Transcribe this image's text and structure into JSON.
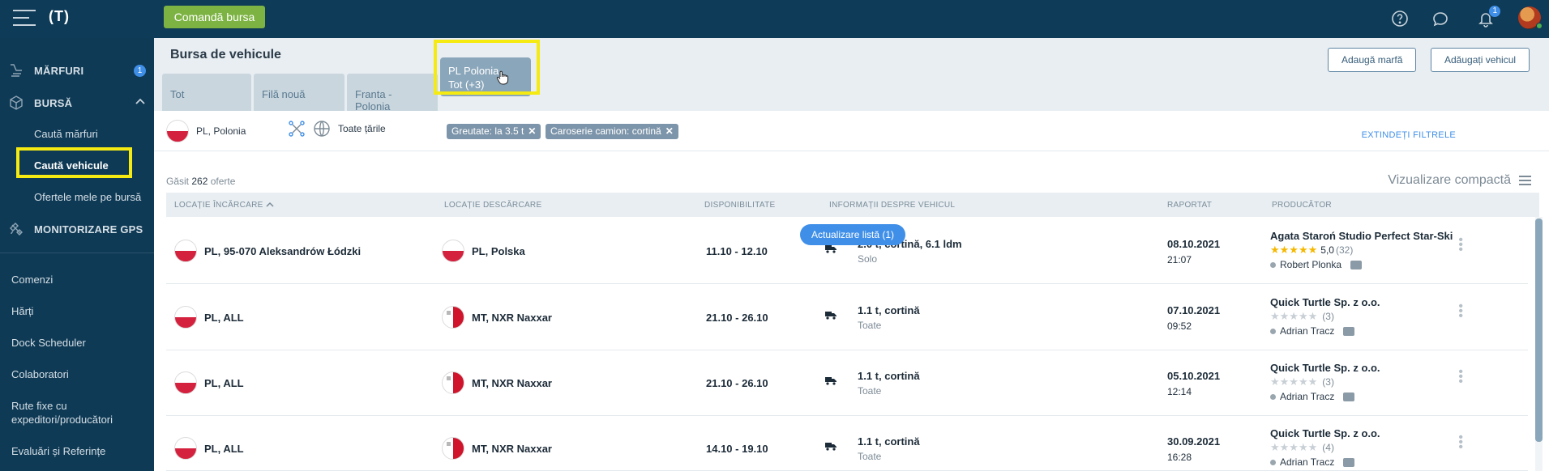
{
  "topbar": {
    "logo": "(T)",
    "cta_label": "Comandă bursa",
    "notif_count": "1",
    "icons": [
      "help-icon",
      "chat-icon",
      "bell-icon"
    ]
  },
  "sidebar": {
    "marfuri_label": "MĂRFURI",
    "marfuri_badge": "1",
    "bursa_label": "BURSĂ",
    "sub_items": [
      "Caută mărfuri",
      "Caută vehicule",
      "Ofertele mele pe bursă"
    ],
    "gps_label": "MONITORIZARE GPS",
    "links": [
      "Comenzi",
      "Hărți",
      "Dock Scheduler",
      "Colaboratori",
      "Rute fixe cu expeditori/producători",
      "Evaluări și Referințe"
    ]
  },
  "header": {
    "title": "Bursa de vehicule",
    "tabs": [
      "Tot",
      "Filă nouă",
      "Franta - Polonia"
    ],
    "active_tab_line1": "PL Polonia",
    "active_tab_line2": "Tot (+3)",
    "btn_add_cargo": "Adaugă marfă",
    "btn_add_vehicle": "Adăugați vehicul"
  },
  "filters": {
    "origin": "PL, Polonia",
    "destination": "Toate țările",
    "chips": [
      "Greutate: la 3.5 t",
      "Caroserie camion: cortină"
    ],
    "extend_label": "EXTINDEȚI FILTRELE"
  },
  "results": {
    "prefix": "Găsit",
    "count": "262",
    "suffix": "oferte",
    "view_label": "Vizualizare compactă",
    "update_pill": "Actualizare listă (1)"
  },
  "table": {
    "headers": [
      "LOCAȚIE ÎNCĂRCARE",
      "LOCAȚIE DESCĂRCARE",
      "DISPONIBILITATE",
      "INFORMAȚII DESPRE VEHICUL",
      "RAPORTAT",
      "PRODUCĂTOR"
    ],
    "rows": [
      {
        "load": "PL, 95-070 Aleksandrów Łódzki",
        "unload": "PL, Polska",
        "unload_flag": "pl",
        "avail": "11.10 - 12.10",
        "veh": "2.0 t, cortină, 6.1 ldm",
        "veh_sub": "Solo",
        "date": "08.10.2021",
        "time": "21:07",
        "producer": "Agata Staroń Studio Perfect Star-Ski",
        "rating": "5,0",
        "rating_count": "(32)",
        "contact": "Robert Plonka"
      },
      {
        "load": "PL, ALL",
        "unload": "MT, NXR Naxxar",
        "unload_flag": "mt",
        "avail": "21.10 - 26.10",
        "veh": "1.1 t, cortină",
        "veh_sub": "Toate",
        "date": "07.10.2021",
        "time": "09:52",
        "producer": "Quick Turtle Sp. z o.o.",
        "rating": "",
        "rating_count": "(3)",
        "contact": "Adrian Tracz"
      },
      {
        "load": "PL, ALL",
        "unload": "MT, NXR Naxxar",
        "unload_flag": "mt",
        "avail": "21.10 - 26.10",
        "veh": "1.1 t, cortină",
        "veh_sub": "Toate",
        "date": "05.10.2021",
        "time": "12:14",
        "producer": "Quick Turtle Sp. z o.o.",
        "rating": "",
        "rating_count": "(3)",
        "contact": "Adrian Tracz"
      },
      {
        "load": "PL, ALL",
        "unload": "MT, NXR Naxxar",
        "unload_flag": "mt",
        "avail": "14.10 - 19.10",
        "veh": "1.1 t, cortină",
        "veh_sub": "Toate",
        "date": "30.09.2021",
        "time": "16:28",
        "producer": "Quick Turtle Sp. z o.o.",
        "rating": "",
        "rating_count": "(4)",
        "contact": "Adrian Tracz"
      }
    ]
  },
  "colors": {
    "topbar": "#0e3b57",
    "cta": "#7cb342",
    "accent": "#3f8fe8",
    "highlight": "#f5ea11"
  }
}
